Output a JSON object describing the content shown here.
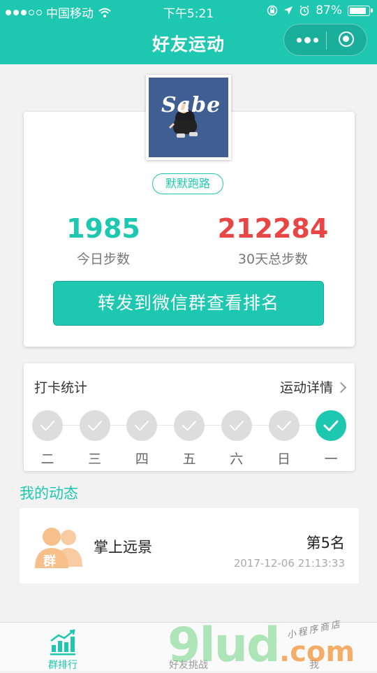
{
  "status_bar": {
    "carrier": "中国移动",
    "time": "下午5:21",
    "battery": "87%",
    "battery_level": 0.87
  },
  "nav": {
    "title": "好友运动"
  },
  "profile": {
    "avatar_text": "Sabe",
    "nickname": "默默跑路",
    "today_steps": "1985",
    "today_label": "今日步数",
    "month_steps": "212284",
    "month_label": "30天总步数",
    "share_button": "转发到微信群查看排名"
  },
  "checkin": {
    "title": "打卡统计",
    "detail_link": "运动详情",
    "days": [
      {
        "label": "二",
        "done": false
      },
      {
        "label": "三",
        "done": false
      },
      {
        "label": "四",
        "done": false
      },
      {
        "label": "五",
        "done": false
      },
      {
        "label": "六",
        "done": false
      },
      {
        "label": "日",
        "done": false
      },
      {
        "label": "一",
        "done": true
      }
    ]
  },
  "dynamics": {
    "title": "我的动态",
    "items": [
      {
        "icon_text": "群",
        "name": "掌上远景",
        "rank": "第5名",
        "time": "2017-12-06 21:13:33"
      }
    ]
  },
  "tabbar": {
    "items": [
      {
        "label": "群排行",
        "active": true
      },
      {
        "label": "好友挑战",
        "active": false
      },
      {
        "label": "我",
        "active": false
      }
    ]
  },
  "watermark": {
    "brand": "9lud",
    "suffix": ".com",
    "tagline": "小程序商店"
  },
  "colors": {
    "accent": "#1ec8b0",
    "red": "#e84545",
    "group_icon": "#f7bf8a"
  }
}
